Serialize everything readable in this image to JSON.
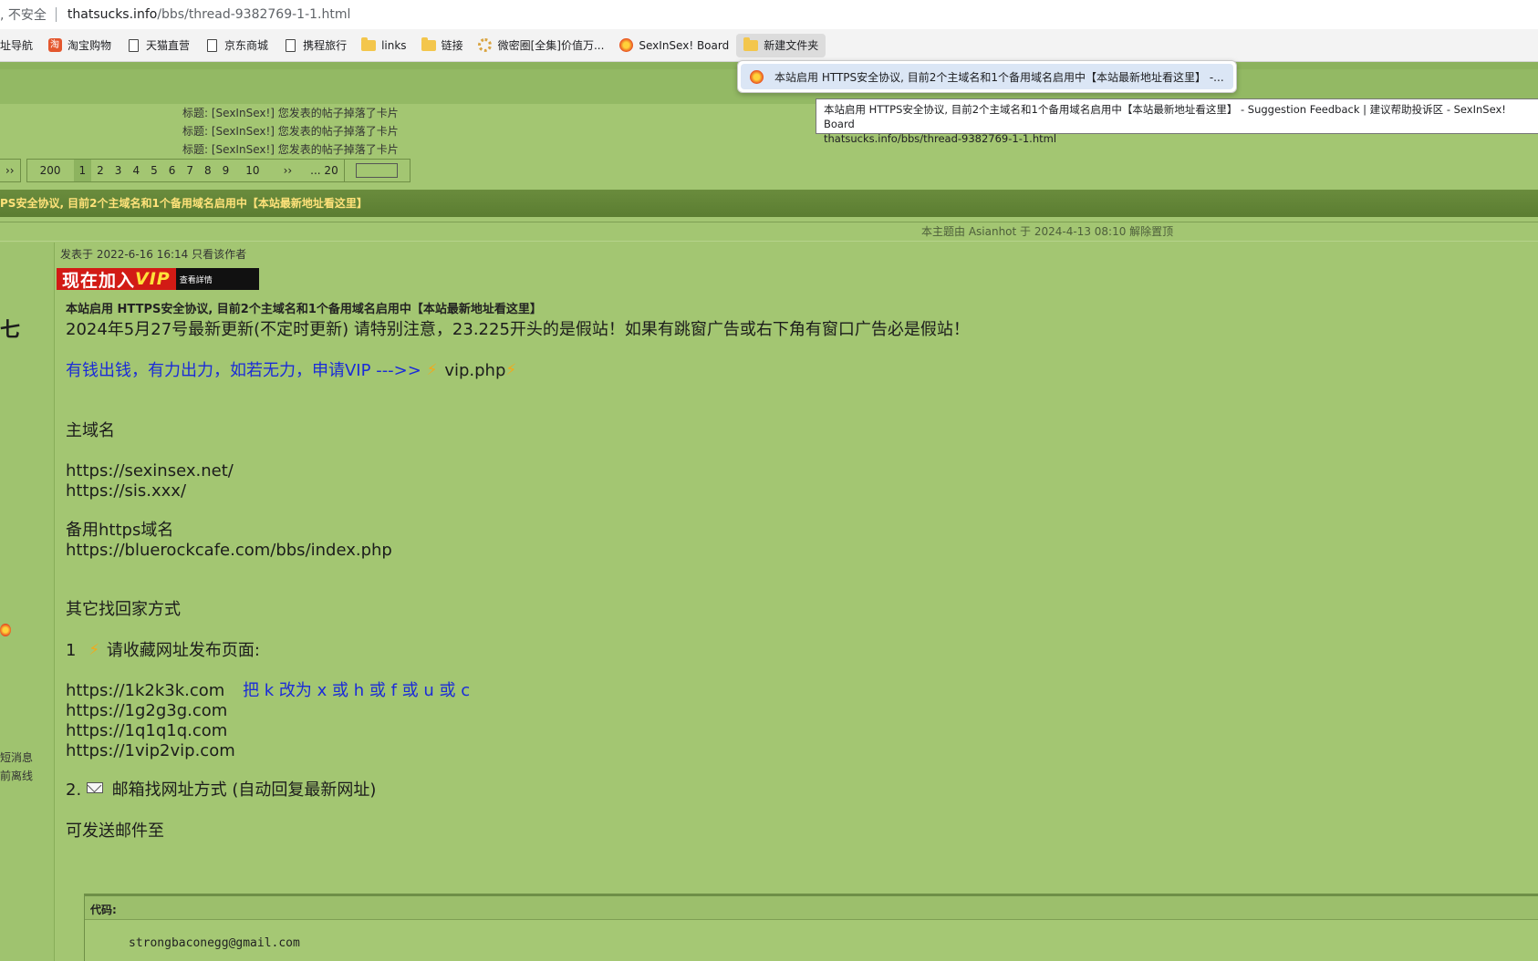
{
  "browser": {
    "security_label": ", 不安全",
    "url_host": "thatsucks.info",
    "url_path": "/bbs/thread-9382769-1-1.html"
  },
  "bookmarks": [
    {
      "label": "网址导航",
      "icon": "globe-icon"
    },
    {
      "label": "淘宝购物",
      "icon": "taobao-icon"
    },
    {
      "label": "天猫直营",
      "icon": "page-icon"
    },
    {
      "label": "京东商城",
      "icon": "page-icon"
    },
    {
      "label": "携程旅行",
      "icon": "page-icon"
    },
    {
      "label": "links",
      "icon": "folder-icon"
    },
    {
      "label": "链接",
      "icon": "folder-icon"
    },
    {
      "label": "微密圈[全集]价值万...",
      "icon": "gear-icon"
    },
    {
      "label": "SexInSex! Board",
      "icon": "site-icon"
    },
    {
      "label": "新建文件夹",
      "icon": "folder-icon"
    }
  ],
  "folder_menu": {
    "item_label": "本站启用 HTTPS安全协议, 目前2个主域名和1个备用域名启用中【本站最新地址看这里】 -..."
  },
  "tooltip": {
    "line1": "本站启用 HTTPS安全协议, 目前2个主域名和1个备用域名启用中【本站最新地址看这里】 - Suggestion Feedback | 建议帮助投诉区 - SexInSex! Board",
    "line2": "thatsucks.info/bbs/thread-9382769-1-1.html"
  },
  "recent_notices": [
    "标题: [SexInSex!] 您发表的帖子掉落了卡片",
    "标题: [SexInSex!] 您发表的帖子掉落了卡片",
    "标题: [SexInSex!] 您发表的帖子掉落了卡片"
  ],
  "pager": {
    "prev": "››",
    "total": "200",
    "pages": [
      "1",
      "2",
      "3",
      "4",
      "5",
      "6",
      "7",
      "8",
      "9",
      "10"
    ],
    "current": "1",
    "next": "››",
    "last": "... 20"
  },
  "thread_title": "PS安全协议, 目前2个主域名和1个备用域名启用中【本站最新地址看这里】",
  "moderation_line": "本主题由 Asianhot 于 2024-4-13 08:10 解除置顶",
  "sidebar": {
    "pm_link": "短消息",
    "status": "前离线"
  },
  "post": {
    "meta": "发表于 2022-6-16 16:14  只看该作者",
    "vip_banner": {
      "text1": "现在加入",
      "text2": "VIP",
      "detail": "查看詳情"
    },
    "notice": "本站启用 HTTPS安全协议, 目前2个主域名和1个备用域名启用中【本站最新地址看这里】",
    "update_line": "2024年5月27号最新更新(不定时更新) 请特别注意，23.225开头的是假站！如果有跳窗广告或右下角有窗口广告必是假站！",
    "vip_line": "有钱出钱，有力出力，如若无力，申请VIP --->>",
    "vip_link": "vip.php",
    "main_domain_heading": "主域名",
    "main_domains": [
      "https://sexinsex.net/",
      "https://sis.xxx/"
    ],
    "backup_heading": "备用https域名",
    "backup_domain": "https://bluerockcafe.com/bbs/index.php",
    "other_heading": "其它找回家方式",
    "step1_num": "1",
    "step1_text": "请收藏网址发布页面:",
    "publish_sites": [
      "https://1k2k3k.com",
      "https://1g2g3g.com",
      "https://1q1q1q.com",
      "https://1vip2vip.com"
    ],
    "replace_hint": "把 k 改为 x 或 h 或 f 或 u 或 c",
    "step2_num": "2.",
    "step2_text": "邮箱找网址方式  (自动回复最新网址)",
    "send_to": "可发送邮件至",
    "code_label": "代码:",
    "code_email": "strongbaconegg@gmail.com"
  },
  "colors": {
    "page_bg": "#a3c672",
    "title_bar": "#5b7d31",
    "title_text": "#ffe27a",
    "link_blue": "#1a2bd8"
  }
}
